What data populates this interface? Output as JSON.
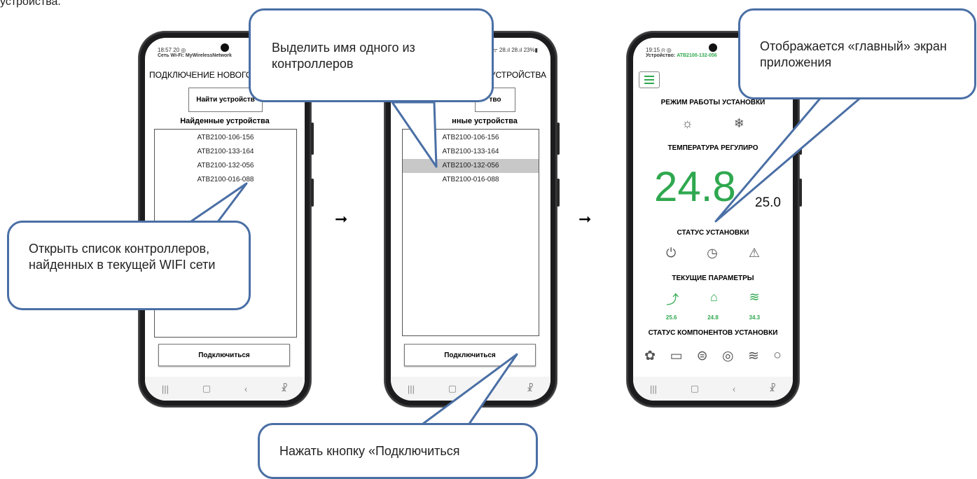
{
  "top_text": "устройства.",
  "screen1": {
    "status_time": "18:57 20 ◎",
    "status_wifi": "Сеть Wi-Fi: MyWirelessNetwork",
    "title": "ПОДКЛЮЧЕНИЕ НОВОГО",
    "find_button": "Найти устройств",
    "found_header": "Найденные устройства",
    "devices": [
      "ATB2100-106-156",
      "ATB2100-133-164",
      "ATB2100-132-056",
      "ATB2100-016-088"
    ],
    "connect_button": "Подключиться"
  },
  "screen2": {
    "status_right": "ᯤ 28.ıl 28.ıl 23%▮",
    "title": "УСТРОЙСТВА",
    "find_button": "тво",
    "found_header": "нные устройства",
    "devices": [
      "ATB2100-106-156",
      "ATB2100-133-164",
      "ATB2100-132-056",
      "ATB2100-016-088"
    ],
    "connect_button": "Подключиться"
  },
  "screen3": {
    "status_time": "19:15 ⍾ ◎",
    "device_label": "Устройство:",
    "device_name": "ATB2100-132-056",
    "mode_header": "РЕЖИМ РАБОТЫ УСТАНОВКИ",
    "temp_header": "ТЕМПЕРАТУРА РЕГУЛИРО",
    "temp_current": "24.8",
    "temp_setpoint": "25.0",
    "status_header": "СТАТУС УСТАНОВКИ",
    "params_header": "ТЕКУЩИЕ ПАРАМЕТРЫ",
    "param_values": [
      "25.6",
      "24.8",
      "34.3"
    ],
    "components_header": "СТАТУС КОМПОНЕНТОВ УСТАНОВКИ"
  },
  "callouts": {
    "select_name": "Выделить имя одного из контроллеров",
    "open_list": "Открыть список контроллеров, найденных в текущей WIFI сети",
    "press_connect": "Нажать кнопку «Подключиться",
    "main_screen": "Отображается «главный» экран приложения"
  },
  "nav_icons": [
    "|||",
    "▢",
    "‹",
    "☧"
  ],
  "colors": {
    "accent_green": "#2fa84f",
    "callout_border": "#4a6fa5"
  }
}
